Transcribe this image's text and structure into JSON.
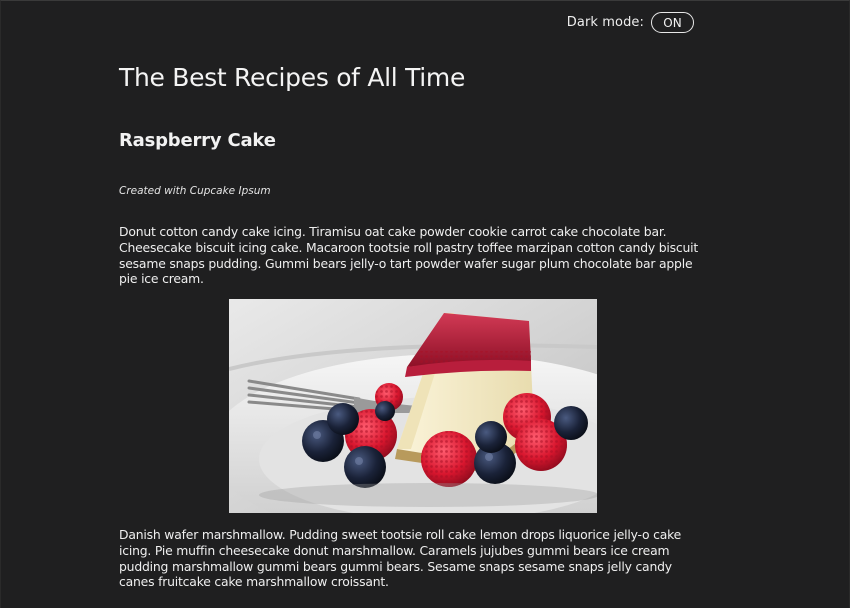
{
  "dark_mode": {
    "label": "Dark mode:",
    "toggle_value": "ON"
  },
  "page": {
    "title": "The Best Recipes of All Time"
  },
  "recipe": {
    "name": "Raspberry Cake",
    "credit": "Created with Cupcake Ipsum",
    "paragraph1": "Donut cotton candy cake icing. Tiramisu oat cake powder cookie carrot cake chocolate bar. Cheesecake biscuit icing cake. Macaroon tootsie roll pastry toffee marzipan cotton candy biscuit sesame snaps pudding. Gummi bears jelly-o tart powder wafer sugar plum chocolate bar apple pie ice cream.",
    "paragraph2": "Danish wafer marshmallow. Pudding sweet tootsie roll cake lemon drops liquorice jelly-o cake icing. Pie muffin cheesecake donut marshmallow. Caramels jujubes gummi bears ice cream pudding marshmallow gummi bears gummi bears. Sesame snaps sesame snaps jelly candy canes fruitcake cake marshmallow croissant."
  },
  "colors": {
    "background": "#1f1f20",
    "text": "#f2f2f2",
    "toggle_border": "#e8e8e8"
  }
}
